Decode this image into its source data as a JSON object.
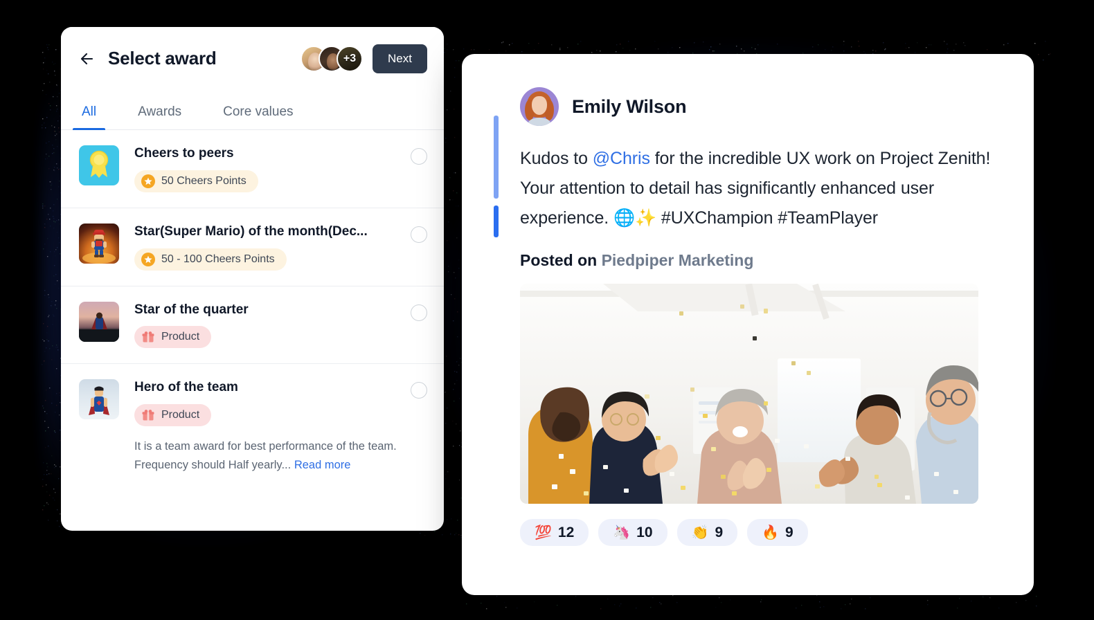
{
  "background_color": "#000000",
  "left_panel": {
    "back_icon": "arrow-left-icon",
    "title": "Select award",
    "avatars": [
      {
        "name": "avatar-1"
      },
      {
        "name": "avatar-2"
      },
      {
        "name": "avatar-overflow",
        "label": "+3"
      }
    ],
    "next_label": "Next",
    "next_color": "#2f3b4d",
    "tabs": [
      {
        "label": "All",
        "active": true
      },
      {
        "label": "Awards",
        "active": false
      },
      {
        "label": "Core values",
        "active": false
      }
    ],
    "active_tab_color": "#1a6ae0",
    "awards": [
      {
        "thumb": "medal-ribbon-icon",
        "name": "Cheers to peers",
        "badge_label": "50 Cheers Points",
        "badge_icon": "star-icon",
        "badge_type": "points",
        "selected": false
      },
      {
        "thumb": "super-mario-figure",
        "name": "Star(Super Mario) of the month(Dec...",
        "badge_label": "50 - 100 Cheers Points",
        "badge_icon": "star-icon",
        "badge_type": "points",
        "selected": false
      },
      {
        "thumb": "superman-sunset-photo",
        "name": "Star of the quarter",
        "badge_label": "Product",
        "badge_icon": "gift-icon",
        "badge_type": "product",
        "selected": false
      },
      {
        "thumb": "superman-sky-photo",
        "name": "Hero of the team",
        "badge_label": "Product",
        "badge_icon": "gift-icon",
        "badge_type": "product",
        "selected": false,
        "description": "It is a team award for best performance of the team. Frequency should Half yearly...",
        "read_more_label": "Read more"
      }
    ]
  },
  "right_panel": {
    "author": "Emily Wilson",
    "avatar": "emily-wilson-avatar",
    "accent_colors": {
      "top": "#7ea3f4",
      "bottom": "#2b6ef0"
    },
    "message_parts": [
      {
        "text": "Kudos to ",
        "type": "plain"
      },
      {
        "text": "@Chris",
        "type": "mention"
      },
      {
        "text": " for the incredible UX work on Project Zenith! Your attention to detail has significantly enhanced user experience. 🌐✨ #UXChampion #TeamPlayer",
        "type": "plain"
      }
    ],
    "posted_on_label": "Posted on",
    "posted_on_org": "Piedpiper Marketing",
    "image_alt": "team-celebration-confetti-photo",
    "reactions": [
      {
        "emoji": "💯",
        "name": "hundred-points-reaction",
        "count": "12"
      },
      {
        "emoji": "🦄",
        "name": "unicorn-reaction",
        "count": "10"
      },
      {
        "emoji": "👏",
        "name": "clap-reaction",
        "count": "9"
      },
      {
        "emoji": "🔥",
        "name": "fire-reaction",
        "count": "9"
      }
    ]
  }
}
